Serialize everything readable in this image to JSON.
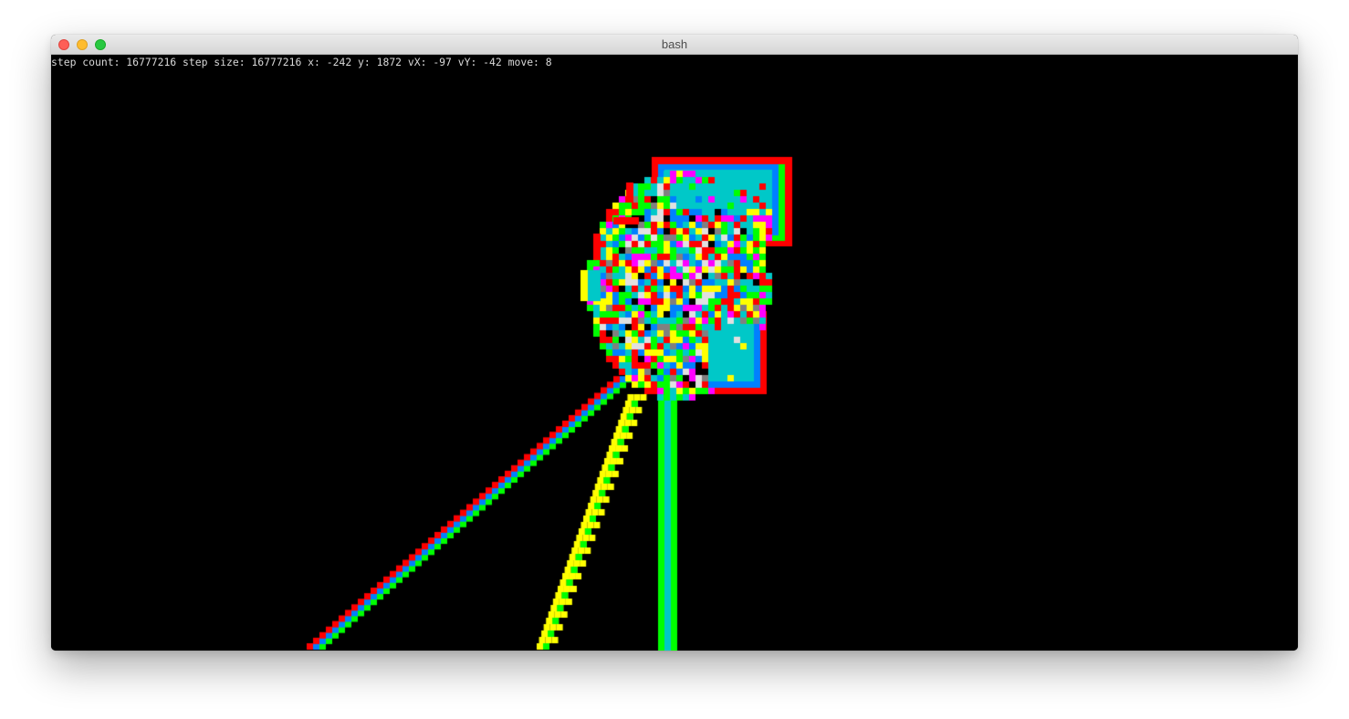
{
  "window": {
    "title": "bash",
    "controls": [
      "close",
      "minimize",
      "zoom"
    ],
    "colors": {
      "close": "#fe5f57",
      "minimize": "#febc2e",
      "zoom": "#28c840"
    }
  },
  "terminal": {
    "status_line": "step count: 16777216 step size: 16777216 x: -242 y: 1872 vX: -97 vY: -42 move: 8",
    "background": "#000000"
  },
  "visualization": {
    "palette": [
      "#ff0000",
      "#00ff00",
      "#ffff00",
      "#00c8c8",
      "#0080ff",
      "#ff00ff",
      "#e0e0e0",
      "#808080",
      "#000000"
    ]
  }
}
